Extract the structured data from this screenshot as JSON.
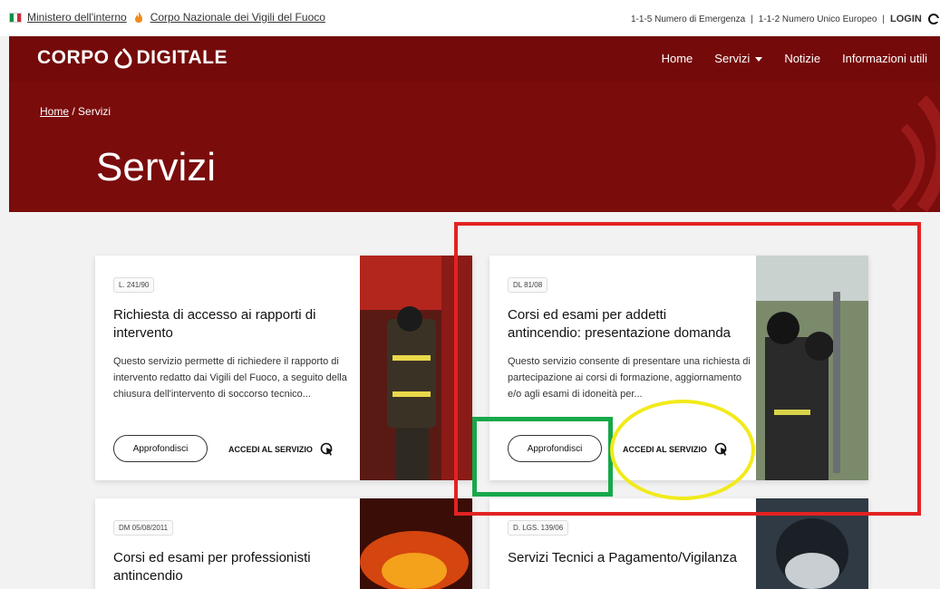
{
  "topbar": {
    "ministry_link": "Ministero dell'interno",
    "corps_link": "Corpo Nazionale dei Vigili del Fuoco",
    "emergency_1": "1-1-5 Numero di Emergenza",
    "separator": "|",
    "emergency_2": "1-1-2 Numero Unico Europeo",
    "login": "LOGIN"
  },
  "header": {
    "logo_left": "CORPO",
    "logo_right": "DIGITALE",
    "nav": [
      "Home",
      "Servizi",
      "Notizie",
      "Informazioni utili"
    ]
  },
  "breadcrumb": {
    "home": "Home",
    "separator": "/",
    "current": "Servizi"
  },
  "page_title": "Servizi",
  "cards": [
    {
      "badge": "L. 241/90",
      "title": "Richiesta di accesso ai rapporti di intervento",
      "description": "Questo servizio permette di richiedere il rapporto di intervento redatto dai Vigili del Fuoco, a seguito della chiusura dell'intervento di soccorso tecnico...",
      "more_label": "Approfondisci",
      "access_label": "ACCEDI AL SERVIZIO"
    },
    {
      "badge": "DL 81/08",
      "title": "Corsi ed esami per addetti antincendio: presentazione domanda",
      "description": "Questo servizio consente di presentare una richiesta di partecipazione ai corsi di formazione, aggiornamento e/o agli esami di idoneità per...",
      "more_label": "Approfondisci",
      "access_label": "ACCEDI AL SERVIZIO"
    },
    {
      "badge": "DM 05/08/2011",
      "title": "Corsi ed esami per professionisti antincendio"
    },
    {
      "badge": "D. LGS. 139/06",
      "title": "Servizi Tecnici a Pagamento/Vigilanza"
    }
  ],
  "colors": {
    "brand": "#7a0c0c",
    "highlight_red": "#e32222",
    "highlight_green": "#17a84a",
    "highlight_yellow": "#f2ea1a"
  }
}
